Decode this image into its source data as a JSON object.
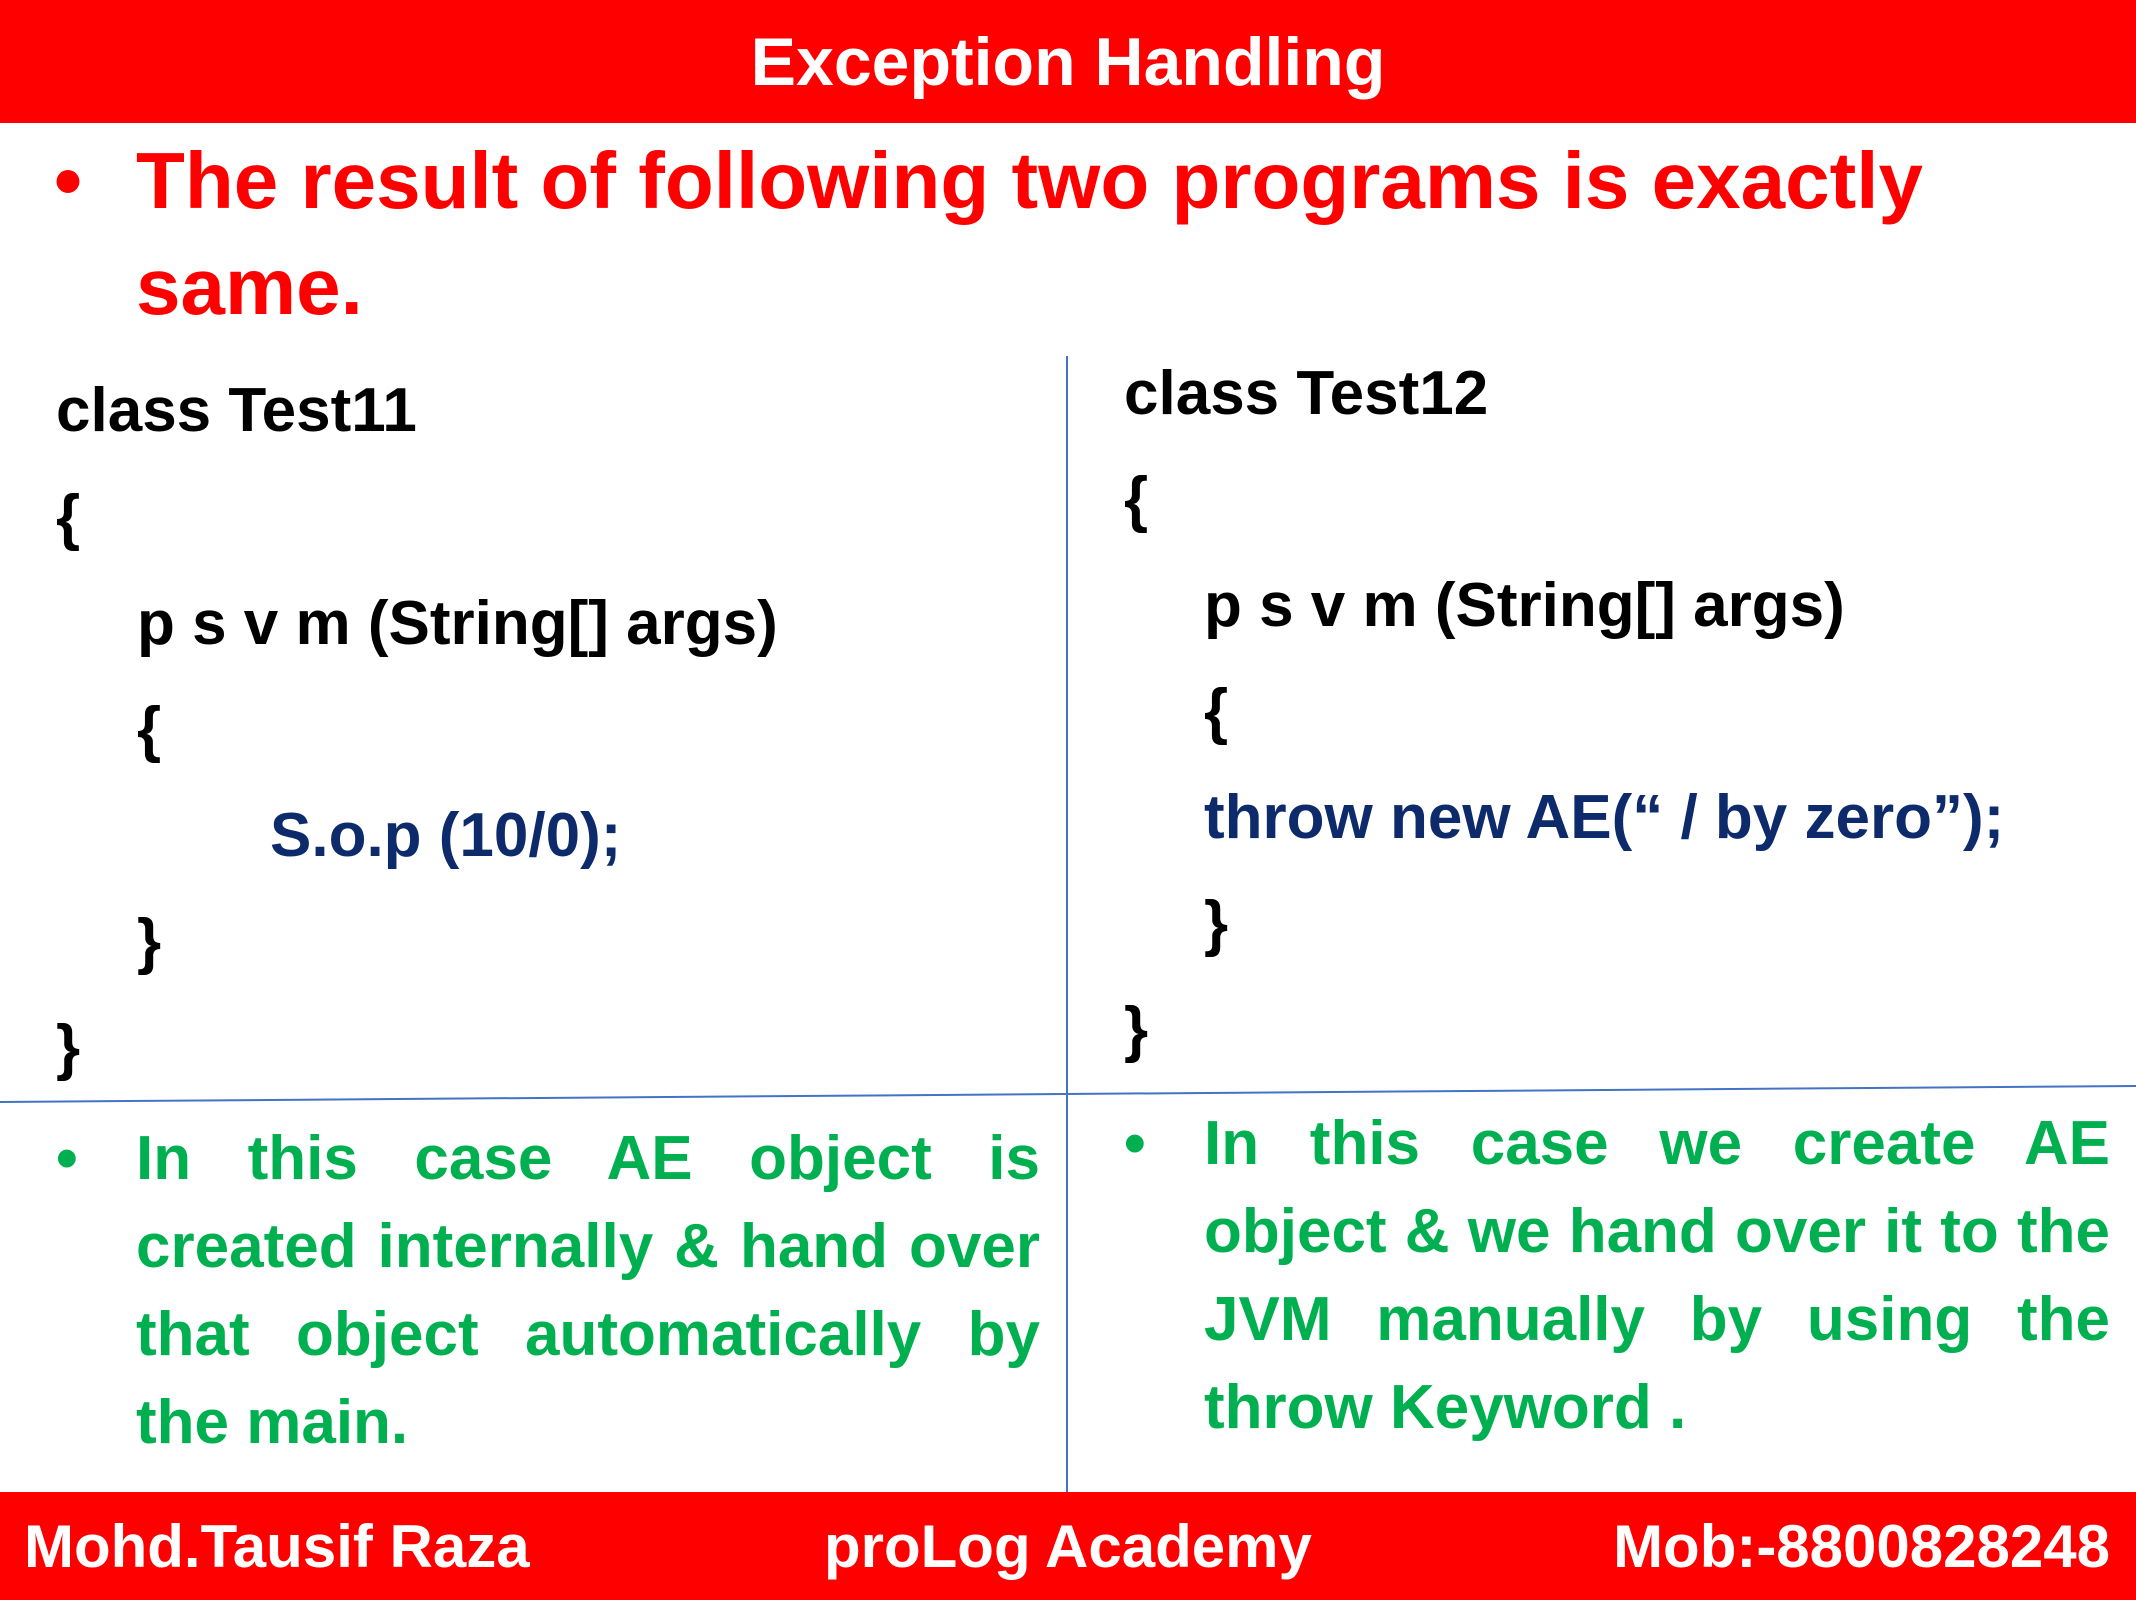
{
  "header": {
    "title": "Exception Handling"
  },
  "heading": {
    "bullet": "•",
    "text": "The result of following two programs is exactly same."
  },
  "left_program": {
    "lines": [
      "class Test11",
      "{",
      "p s v m (String[] args)",
      "{",
      "S.o.p (10/0);",
      "}",
      "}"
    ]
  },
  "right_program": {
    "lines": [
      "class Test12",
      "{",
      "p s v m (String[] args)",
      "{",
      "throw new AE(“ / by zero”);",
      "}",
      "}"
    ]
  },
  "left_note": {
    "bullet": "•",
    "text": "In this case AE object is created internally & hand over that object automatically by the main."
  },
  "right_note": {
    "bullet": "•",
    "text": "In this case we create AE object & we hand over it to the JVM manually by using the throw Keyword ."
  },
  "footer": {
    "author": "Mohd.Tausif Raza",
    "academy": "proLog Academy",
    "phone": "Mob:-8800828248"
  },
  "colors": {
    "banner": "#ff0000",
    "heading": "#ff0000",
    "code_highlight": "#0d2a6b",
    "note": "#00b050",
    "divider": "#4472c4"
  }
}
